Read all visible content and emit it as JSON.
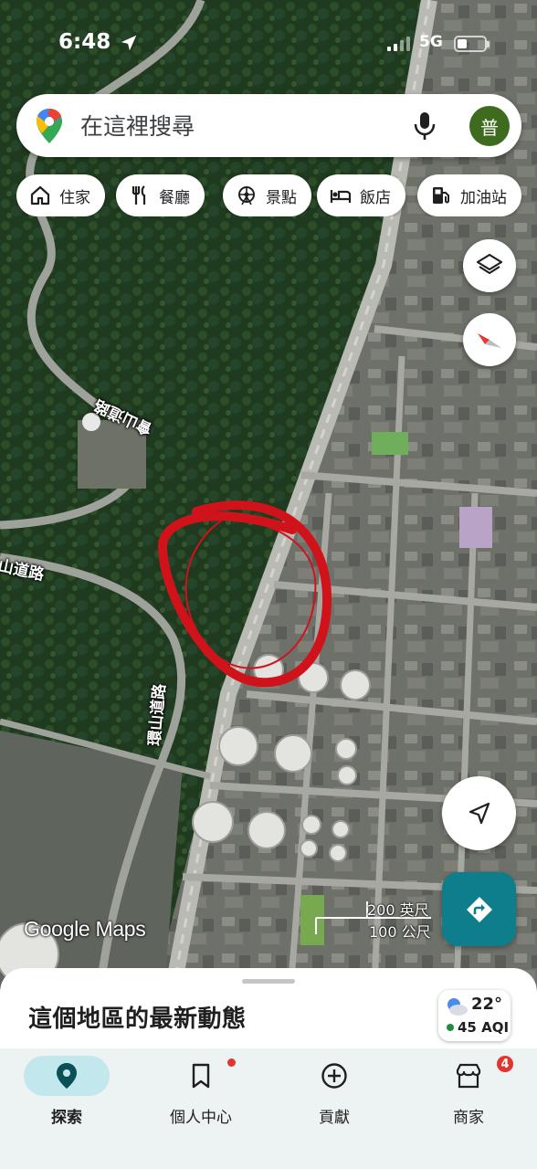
{
  "status_bar": {
    "time": "6:48",
    "network": "5G",
    "battery_level_percent": 35
  },
  "search": {
    "placeholder": "在這裡搜尋",
    "avatar_initial": "普"
  },
  "chips": [
    {
      "icon": "home-icon",
      "label": "住家"
    },
    {
      "icon": "restaurant-icon",
      "label": "餐廳"
    },
    {
      "icon": "attraction-icon",
      "label": "景點"
    },
    {
      "icon": "hotel-icon",
      "label": "飯店"
    },
    {
      "icon": "gas-station-icon",
      "label": "加油站"
    }
  ],
  "map": {
    "road_labels": [
      "會山道路",
      "山道路",
      "環山道路"
    ],
    "watermark": "Google Maps",
    "scale": {
      "imperial": "200 英尺",
      "metric": "100 公尺"
    },
    "annotation_color": "#d0121b"
  },
  "sheet": {
    "title": "這個地區的最新動態",
    "weather": {
      "temperature": "22°",
      "aqi": "45 AQI",
      "aqi_color": "#1e8e3e"
    }
  },
  "nav": [
    {
      "icon": "explore-pin-icon",
      "label": "探索",
      "active": true
    },
    {
      "icon": "bookmark-icon",
      "label": "個人中心",
      "badge": "dot"
    },
    {
      "icon": "contribute-icon",
      "label": "貢獻"
    },
    {
      "icon": "business-icon",
      "label": "商家",
      "badge_count": "4"
    }
  ],
  "colors": {
    "accent": "#0f7e8c",
    "nav_active": "#c2e7ec",
    "avatar": "#3f6b1f"
  }
}
